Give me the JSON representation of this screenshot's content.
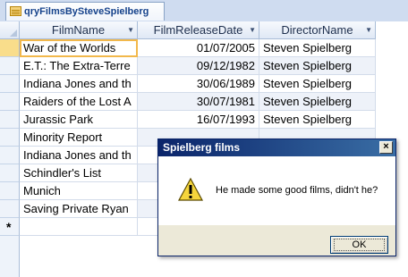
{
  "tab": {
    "title": "qryFilmsBySteveSpielberg"
  },
  "columns": [
    {
      "label": "FilmName"
    },
    {
      "label": "FilmReleaseDate"
    },
    {
      "label": "DirectorName"
    }
  ],
  "rows": [
    {
      "film": "War of the Worlds",
      "date": "01/07/2005",
      "director": "Steven Spielberg"
    },
    {
      "film": "E.T.: The Extra-Terre",
      "date": "09/12/1982",
      "director": "Steven Spielberg"
    },
    {
      "film": "Indiana Jones and th",
      "date": "30/06/1989",
      "director": "Steven Spielberg"
    },
    {
      "film": "Raiders of the Lost A",
      "date": "30/07/1981",
      "director": "Steven Spielberg"
    },
    {
      "film": "Jurassic Park",
      "date": "16/07/1993",
      "director": "Steven Spielberg"
    },
    {
      "film": "Minority Report",
      "date": "",
      "director": ""
    },
    {
      "film": "Indiana Jones and th",
      "date": "",
      "director": ""
    },
    {
      "film": "Schindler's List",
      "date": "",
      "director": ""
    },
    {
      "film": "Munich",
      "date": "",
      "director": ""
    },
    {
      "film": "Saving Private Ryan",
      "date": "",
      "director": ""
    }
  ],
  "new_row_marker": "*",
  "dialog": {
    "title": "Spielberg films",
    "close_glyph": "×",
    "message": "He made some good films, didn't he?",
    "ok_label": "OK",
    "icon": "warning-icon"
  }
}
